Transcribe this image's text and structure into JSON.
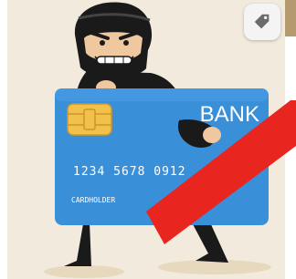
{
  "card": {
    "bank_label": "BANK",
    "number": "1234 5678 0912",
    "holder_label": "CARDHOLDER"
  },
  "icons": {
    "tag": "tag-icon"
  },
  "colors": {
    "background": "#f2ebdd",
    "card_blue": "#3a8fd9",
    "card_blue_dark": "#2473b8",
    "chip_gold": "#f2c14a",
    "strike_red": "#e8251f",
    "mask_black": "#1a1a1a",
    "skin": "#f0c8a0"
  }
}
